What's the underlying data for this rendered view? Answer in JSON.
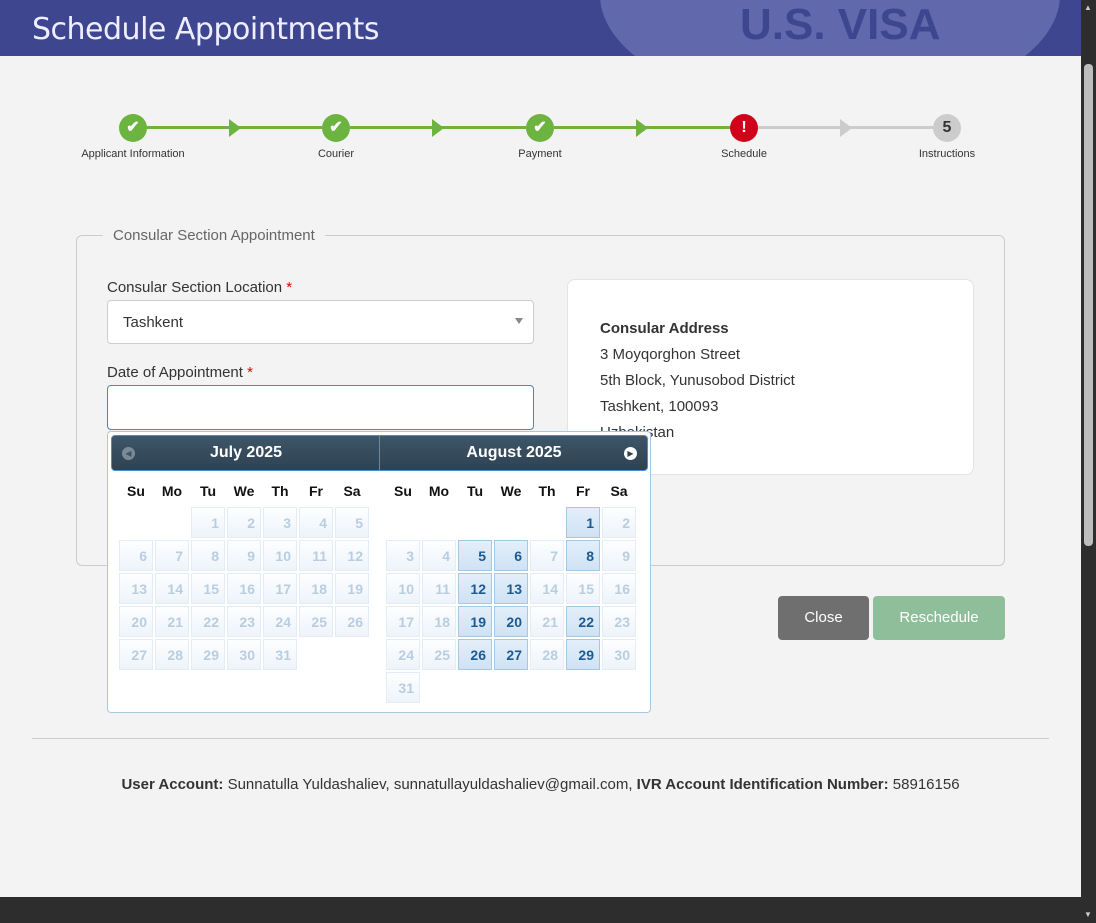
{
  "header": {
    "title": "Schedule Appointments",
    "seal_text": "U.S. VISA"
  },
  "steps": [
    {
      "label": "Applicant Information",
      "status": "done"
    },
    {
      "label": "Courier",
      "status": "done"
    },
    {
      "label": "Payment",
      "status": "done"
    },
    {
      "label": "Schedule",
      "status": "error",
      "mark": "!"
    },
    {
      "label": "Instructions",
      "status": "pending",
      "mark": "5"
    }
  ],
  "colors": {
    "header": "#3f4690",
    "done": "#6db33f",
    "error": "#d0021b",
    "pending": "#cccccc"
  },
  "section": {
    "legend": "Consular Section Appointment",
    "location_label": "Consular Section Location",
    "required": "*",
    "location_value": "Tashkent",
    "date_label": "Date of Appointment",
    "date_value": "",
    "address_title": "Consular Address",
    "address_lines": [
      "3 Moyqorghon Street",
      "5th Block, Yunusobod District",
      "Tashkent, 100093",
      "Uzbekistan"
    ]
  },
  "buttons": {
    "close": "Close",
    "reschedule": "Reschedule"
  },
  "datepicker": {
    "weekdays": [
      "Su",
      "Mo",
      "Tu",
      "We",
      "Th",
      "Fr",
      "Sa"
    ],
    "months": [
      {
        "title": "July 2025",
        "first_weekday": 2,
        "days": 31,
        "available": []
      },
      {
        "title": "August 2025",
        "first_weekday": 5,
        "days": 31,
        "available": [
          1,
          5,
          6,
          8,
          12,
          13,
          19,
          20,
          22,
          26,
          27,
          29
        ]
      }
    ]
  },
  "footer": {
    "user_label": "User Account:",
    "user_value": "Sunnatulla Yuldashaliev, sunnatullayuldashaliev@gmail.com,",
    "ivr_label": "IVR Account Identification Number:",
    "ivr_value": "58916156"
  }
}
